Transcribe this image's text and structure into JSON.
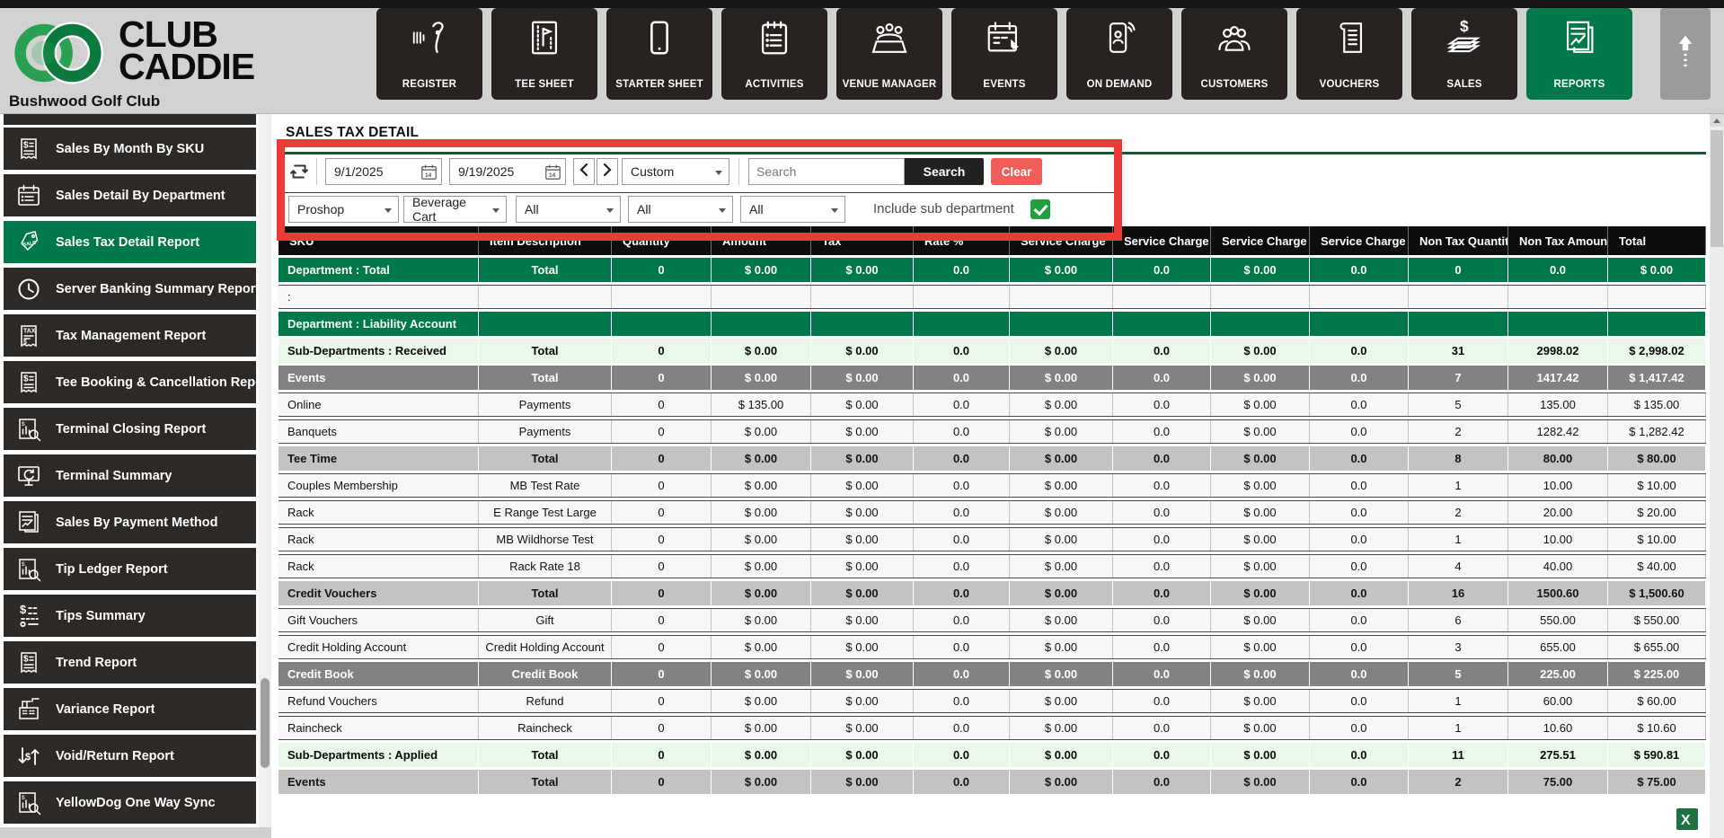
{
  "brand": {
    "name_line1": "CLUB",
    "name_line2": "CADDIE",
    "club_name": "Bushwood Golf Club"
  },
  "colors": {
    "accent_green": "#00784a",
    "annotation_red": "#ee3a36",
    "clear_red": "#f05c58",
    "checkbox_green": "#1fa03c",
    "header_gray": "#d2d2d2",
    "tile_black": "#282320"
  },
  "nav": {
    "items": [
      {
        "label": "REGISTER",
        "icon": "barcode-scanner-icon",
        "active": false
      },
      {
        "label": "TEE SHEET",
        "icon": "tee-flag-icon",
        "active": false
      },
      {
        "label": "STARTER SHEET",
        "icon": "tablet-icon",
        "active": false
      },
      {
        "label": "ACTIVITIES",
        "icon": "clipboard-list-icon",
        "active": false
      },
      {
        "label": "VENUE MANAGER",
        "icon": "banquet-people-icon",
        "active": false
      },
      {
        "label": "EVENTS",
        "icon": "calendar-pencil-icon",
        "active": false
      },
      {
        "label": "ON DEMAND",
        "icon": "phone-broadcast-icon",
        "active": false
      },
      {
        "label": "CUSTOMERS",
        "icon": "people-group-icon",
        "active": false
      },
      {
        "label": "VOUCHERS",
        "icon": "voucher-ticket-icon",
        "active": false
      },
      {
        "label": "SALES",
        "icon": "cash-stack-icon",
        "active": false
      },
      {
        "label": "REPORTS",
        "icon": "report-chart-icon",
        "active": true
      }
    ]
  },
  "sidebar": {
    "items": [
      {
        "label": "Sales By Month By SKU",
        "icon": "receipt-dollar-icon",
        "active": false
      },
      {
        "label": "Sales Detail By Department",
        "icon": "calendar-list-icon",
        "active": false
      },
      {
        "label": "Sales Tax Detail Report",
        "icon": "sale-tag-icon",
        "active": true
      },
      {
        "label": "Server Banking Summary Report",
        "icon": "clock-icon",
        "active": false
      },
      {
        "label": "Tax Management Report",
        "icon": "tax-receipt-icon",
        "active": false
      },
      {
        "label": "Tee Booking & Cancellation Report",
        "icon": "receipt-dollar-icon",
        "active": false
      },
      {
        "label": "Terminal Closing Report",
        "icon": "chart-magnifier-icon",
        "active": false
      },
      {
        "label": "Terminal Summary",
        "icon": "monitor-refresh-icon",
        "active": false
      },
      {
        "label": "Sales By Payment Method",
        "icon": "doc-chart-icon",
        "active": false
      },
      {
        "label": "Tip Ledger Report",
        "icon": "chart-magnifier-icon",
        "active": false
      },
      {
        "label": "Tips Summary",
        "icon": "dollar-list-icon",
        "active": false
      },
      {
        "label": "Trend Report",
        "icon": "receipt-dollar-icon",
        "active": false
      },
      {
        "label": "Variance Report",
        "icon": "cash-register-icon",
        "active": false
      },
      {
        "label": "Void/Return Report",
        "icon": "dollar-cycle-icon",
        "active": false
      },
      {
        "label": "YellowDog One Way Sync",
        "icon": "chart-magnifier-icon",
        "active": false
      }
    ]
  },
  "report": {
    "title": "SALES TAX DETAIL",
    "filters": {
      "date_from": "9/1/2025",
      "date_to": "9/19/2025",
      "range": "Custom",
      "search_placeholder": "Search",
      "search_button": "Search",
      "clear_button": "Clear",
      "department": "Proshop",
      "sub_department": "Beverage Cart",
      "filter3": "All",
      "filter4": "All",
      "filter5": "All",
      "include_sub_department_label": "Include sub department",
      "include_sub_department_checked": true
    },
    "table": {
      "columns": [
        "SKU",
        "Item Description",
        "Quantity",
        "Amount",
        "Tax",
        "Rate %",
        "Service Charge",
        "Service Charge %",
        "Service Charge T",
        "Service Charge T",
        "Non Tax Quantity",
        "Non Tax Amount",
        "Total"
      ],
      "rows": [
        {
          "style": "green",
          "cells": [
            "Department : Total",
            "Total",
            "0",
            "$ 0.00",
            "$ 0.00",
            "0.0",
            "$ 0.00",
            "0.0",
            "$ 0.00",
            "0.0",
            "0",
            "0.0",
            "$ 0.00"
          ]
        },
        {
          "style": "white",
          "cells": [
            ":",
            "",
            "",
            "",
            "",
            "",
            "",
            "",
            "",
            "",
            "",
            "",
            ""
          ]
        },
        {
          "style": "green",
          "cells": [
            "Department : Liability Account",
            "",
            "",
            "",
            "",
            "",
            "",
            "",
            "",
            "",
            "",
            "",
            ""
          ]
        },
        {
          "style": "lightgreen",
          "cells": [
            "Sub-Departments : Received",
            "Total",
            "0",
            "$ 0.00",
            "$ 0.00",
            "0.0",
            "$ 0.00",
            "0.0",
            "$ 0.00",
            "0.0",
            "31",
            "2998.02",
            "$ 2,998.02"
          ]
        },
        {
          "style": "darkgray",
          "cells": [
            "Events",
            "Total",
            "0",
            "$ 0.00",
            "$ 0.00",
            "0.0",
            "$ 0.00",
            "0.0",
            "$ 0.00",
            "0.0",
            "7",
            "1417.42",
            "$ 1,417.42"
          ]
        },
        {
          "style": "white",
          "cells": [
            "Online",
            "Payments",
            "0",
            "$ 135.00",
            "$ 0.00",
            "0.0",
            "$ 0.00",
            "0.0",
            "$ 0.00",
            "0.0",
            "5",
            "135.00",
            "$ 135.00"
          ]
        },
        {
          "style": "white",
          "cells": [
            "Banquets",
            "Payments",
            "0",
            "$ 0.00",
            "$ 0.00",
            "0.0",
            "$ 0.00",
            "0.0",
            "$ 0.00",
            "0.0",
            "2",
            "1282.42",
            "$ 1,282.42"
          ]
        },
        {
          "style": "lightgray",
          "cells": [
            "Tee Time",
            "Total",
            "0",
            "$ 0.00",
            "$ 0.00",
            "0.0",
            "$ 0.00",
            "0.0",
            "$ 0.00",
            "0.0",
            "8",
            "80.00",
            "$ 80.00"
          ]
        },
        {
          "style": "white",
          "cells": [
            "Couples Membership",
            "MB Test Rate",
            "0",
            "$ 0.00",
            "$ 0.00",
            "0.0",
            "$ 0.00",
            "0.0",
            "$ 0.00",
            "0.0",
            "1",
            "10.00",
            "$ 10.00"
          ]
        },
        {
          "style": "white",
          "cells": [
            "Rack",
            "E Range Test Large",
            "0",
            "$ 0.00",
            "$ 0.00",
            "0.0",
            "$ 0.00",
            "0.0",
            "$ 0.00",
            "0.0",
            "2",
            "20.00",
            "$ 20.00"
          ]
        },
        {
          "style": "white",
          "cells": [
            "Rack",
            "MB Wildhorse Test",
            "0",
            "$ 0.00",
            "$ 0.00",
            "0.0",
            "$ 0.00",
            "0.0",
            "$ 0.00",
            "0.0",
            "1",
            "10.00",
            "$ 10.00"
          ]
        },
        {
          "style": "white",
          "cells": [
            "Rack",
            "Rack Rate 18",
            "0",
            "$ 0.00",
            "$ 0.00",
            "0.0",
            "$ 0.00",
            "0.0",
            "$ 0.00",
            "0.0",
            "4",
            "40.00",
            "$ 40.00"
          ]
        },
        {
          "style": "lightgray",
          "cells": [
            "Credit Vouchers",
            "Total",
            "0",
            "$ 0.00",
            "$ 0.00",
            "0.0",
            "$ 0.00",
            "0.0",
            "$ 0.00",
            "0.0",
            "16",
            "1500.60",
            "$ 1,500.60"
          ]
        },
        {
          "style": "white",
          "cells": [
            "Gift Vouchers",
            "Gift",
            "0",
            "$ 0.00",
            "$ 0.00",
            "0.0",
            "$ 0.00",
            "0.0",
            "$ 0.00",
            "0.0",
            "6",
            "550.00",
            "$ 550.00"
          ]
        },
        {
          "style": "white",
          "cells": [
            "Credit Holding Account",
            "Credit Holding Account",
            "0",
            "$ 0.00",
            "$ 0.00",
            "0.0",
            "$ 0.00",
            "0.0",
            "$ 0.00",
            "0.0",
            "3",
            "655.00",
            "$ 655.00"
          ]
        },
        {
          "style": "darkgray",
          "cells": [
            "Credit Book",
            "Credit Book",
            "0",
            "$ 0.00",
            "$ 0.00",
            "0.0",
            "$ 0.00",
            "0.0",
            "$ 0.00",
            "0.0",
            "5",
            "225.00",
            "$ 225.00"
          ]
        },
        {
          "style": "white",
          "cells": [
            "Refund Vouchers",
            "Refund",
            "0",
            "$ 0.00",
            "$ 0.00",
            "0.0",
            "$ 0.00",
            "0.0",
            "$ 0.00",
            "0.0",
            "1",
            "60.00",
            "$ 60.00"
          ]
        },
        {
          "style": "white",
          "cells": [
            "Raincheck",
            "Raincheck",
            "0",
            "$ 0.00",
            "$ 0.00",
            "0.0",
            "$ 0.00",
            "0.0",
            "$ 0.00",
            "0.0",
            "1",
            "10.60",
            "$ 10.60"
          ]
        },
        {
          "style": "lightgreen",
          "cells": [
            "Sub-Departments : Applied",
            "Total",
            "0",
            "$ 0.00",
            "$ 0.00",
            "0.0",
            "$ 0.00",
            "0.0",
            "$ 0.00",
            "0.0",
            "11",
            "275.51",
            "$ 590.81"
          ]
        },
        {
          "style": "lightgray",
          "cells": [
            "Events",
            "Total",
            "0",
            "$ 0.00",
            "$ 0.00",
            "0.0",
            "$ 0.00",
            "0.0",
            "$ 0.00",
            "0.0",
            "2",
            "75.00",
            "$ 75.00"
          ]
        }
      ]
    }
  }
}
